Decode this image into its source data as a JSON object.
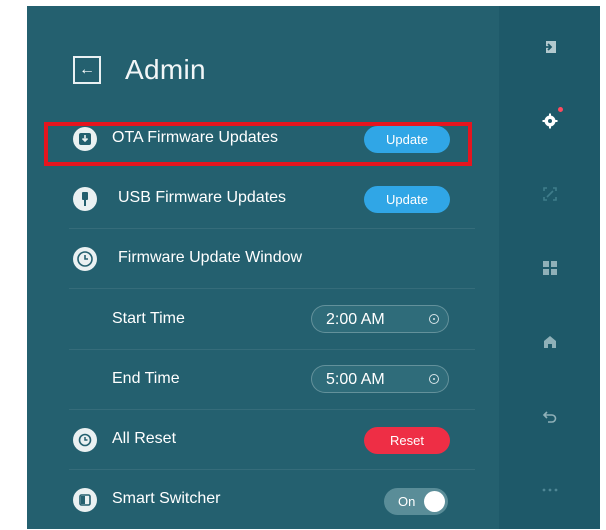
{
  "header": {
    "title": "Admin"
  },
  "rows": {
    "ota": {
      "label": "OTA Firmware Updates",
      "button": "Update"
    },
    "usb": {
      "label": "USB Firmware Updates",
      "button": "Update"
    },
    "window": {
      "label": "Firmware Update Window"
    },
    "start": {
      "label": "Start Time",
      "value": "2:00 AM"
    },
    "end": {
      "label": "End Time",
      "value": "5:00 AM"
    },
    "reset": {
      "label": "All Reset",
      "button": "Reset"
    },
    "switcher": {
      "label": "Smart Switcher",
      "toggle": "On"
    }
  },
  "rail": {
    "items": [
      "exit-icon",
      "settings-icon",
      "screen-share-icon",
      "apps-grid-icon",
      "home-icon",
      "back-icon",
      "more-icon"
    ]
  },
  "colors": {
    "background": "#24606f",
    "rail": "#1e5969",
    "accent_blue": "#30a6e6",
    "accent_red": "#ee2e45",
    "highlight": "#e5151f"
  }
}
